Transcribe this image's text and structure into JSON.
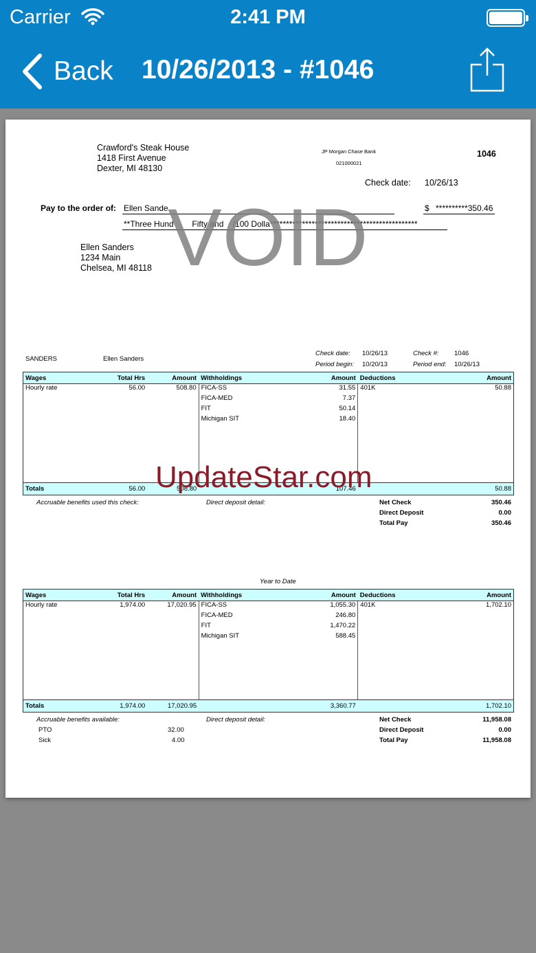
{
  "status_bar": {
    "carrier": "Carrier",
    "time": "2:41 PM"
  },
  "nav": {
    "back_label": "Back",
    "title": "10/26/2013 - #1046"
  },
  "check": {
    "company_lines": [
      "Crawford's Steak House",
      "1418 First Avenue",
      "Dexter, MI 48130"
    ],
    "bank_name": "JP Morgan Chase Bank",
    "routing": "021000021",
    "number": "1046",
    "check_date_label": "Check date:",
    "check_date": "10/26/13",
    "pay_to_label": "Pay to the order of:",
    "payee": "Ellen Sande",
    "dollar_sign": "$",
    "amount": "**********350.46",
    "amount_words": "**Three Hund        Fifty and    /100 Dolla**********************************************",
    "void": "VOID",
    "payee_address": [
      "Ellen Sanders",
      "1234 Main",
      "Chelsea, MI 48118"
    ]
  },
  "stub": {
    "employee_code": "SANDERS",
    "employee_name": "Ellen Sanders",
    "check_date_label": "Check date:",
    "check_date": "10/26/13",
    "period_begin_label": "Period begin:",
    "period_begin": "10/20/13",
    "check_num_label": "Check #:",
    "check_num": "1046",
    "period_end_label": "Period end:",
    "period_end": "10/26/13"
  },
  "headers": {
    "wages": "Wages",
    "total_hrs": "Total Hrs",
    "amount": "Amount",
    "withholdings": "Withholdings",
    "deductions": "Deductions"
  },
  "current": {
    "wages": [
      {
        "name": "Hourly rate",
        "hrs": "56.00",
        "amount": "508.80"
      }
    ],
    "withholdings": [
      {
        "name": "FICA-SS",
        "amount": "31.55"
      },
      {
        "name": "FICA-MED",
        "amount": "7.37"
      },
      {
        "name": "FIT",
        "amount": "50.14"
      },
      {
        "name": "Michigan SIT",
        "amount": "18.40"
      }
    ],
    "deductions": [
      {
        "name": "401K",
        "amount": "50.88"
      }
    ],
    "totals": {
      "label": "Totals",
      "hrs": "56.00",
      "wages": "508.80",
      "withholdings": "107.46",
      "deductions": "50.88"
    },
    "benefits_label": "Accruable benefits used this check:",
    "deposit_label": "Direct deposit detail:",
    "summary": [
      {
        "label": "Net Check",
        "value": "350.46"
      },
      {
        "label": "Direct Deposit",
        "value": "0.00"
      },
      {
        "label": "Total Pay",
        "value": "350.46"
      }
    ]
  },
  "ytd": {
    "title": "Year to Date",
    "wages": [
      {
        "name": "Hourly rate",
        "hrs": "1,974.00",
        "amount": "17,020.95"
      }
    ],
    "withholdings": [
      {
        "name": "FICA-SS",
        "amount": "1,055.30"
      },
      {
        "name": "FICA-MED",
        "amount": "246.80"
      },
      {
        "name": "FIT",
        "amount": "1,470.22"
      },
      {
        "name": "Michigan SIT",
        "amount": "588.45"
      }
    ],
    "deductions": [
      {
        "name": "401K",
        "amount": "1,702.10"
      }
    ],
    "totals": {
      "label": "Totals",
      "hrs": "1,974.00",
      "wages": "17,020.95",
      "withholdings": "3,360.77",
      "deductions": "1,702.10"
    },
    "benefits_label": "Accruable benefits available:",
    "benefits": [
      {
        "name": "PTO",
        "value": "32.00"
      },
      {
        "name": "Sick",
        "value": "4.00"
      }
    ],
    "deposit_label": "Direct deposit detail:",
    "summary": [
      {
        "label": "Net Check",
        "value": "11,958.08"
      },
      {
        "label": "Direct Deposit",
        "value": "0.00"
      },
      {
        "label": "Total Pay",
        "value": "11,958.08"
      }
    ]
  },
  "watermark": "UpdateStar.com",
  "icons": {
    "back": "chevron-left-icon",
    "share": "share-icon",
    "wifi": "wifi-icon",
    "battery": "battery-icon"
  },
  "colors": {
    "nav_bg": "#0a82c8",
    "table_header": "#ccfdff",
    "background": "#8a8a8a",
    "watermark": "#8a1c2a"
  }
}
